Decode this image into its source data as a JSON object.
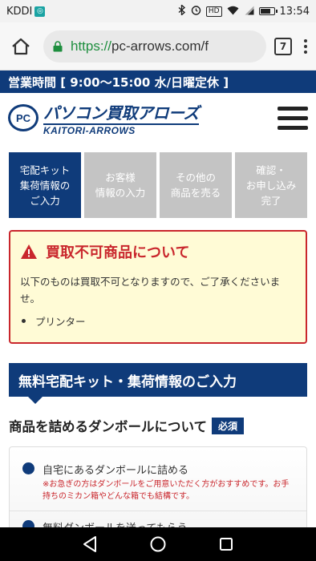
{
  "status_bar": {
    "carrier": "KDDI",
    "carrier_badge": "◎",
    "hd": "HD",
    "time": "13:54",
    "battery_level": 0.8
  },
  "browser": {
    "url_scheme": "https://",
    "url_host": "pc-arrows.com/f",
    "tab_count": "7"
  },
  "hours_banner": "営業時間 [ 9:00〜15:00 水/日曜定休 ]",
  "logo": {
    "badge": "PC",
    "name_jp": "パソコン買取アローズ",
    "name_en": "KAITORI-ARROWS"
  },
  "steps": [
    {
      "label": "宅配キット\n集荷情報の\nご入力",
      "active": true
    },
    {
      "label": "お客様\n情報の入力",
      "active": false
    },
    {
      "label": "その他の\n商品を売る",
      "active": false
    },
    {
      "label": "確認・\nお申し込み\n完了",
      "active": false
    }
  ],
  "alert": {
    "title": "買取不可商品について",
    "body": "以下のものは買取不可となりますので、ご了承くださいませ。",
    "items": [
      "プリンター"
    ]
  },
  "section_heading": "無料宅配キット・集荷情報のご入力",
  "box_question": {
    "label": "商品を詰めるダンボールについて",
    "required_badge": "必須"
  },
  "options": [
    {
      "label": "自宅にあるダンボールに詰める",
      "note": "※お急ぎの方はダンボールをご用意いただく方がおすすめです。お手持ちのミカン箱やどんな箱でも結構です。"
    },
    {
      "label": "無料ダンボールを送ってもらう",
      "note": ""
    }
  ],
  "colors": {
    "brand_navy": "#0f3b7a",
    "alert_red": "#c9262c",
    "alert_bg": "#fffbd6",
    "step_inactive": "#c4c4c4"
  }
}
